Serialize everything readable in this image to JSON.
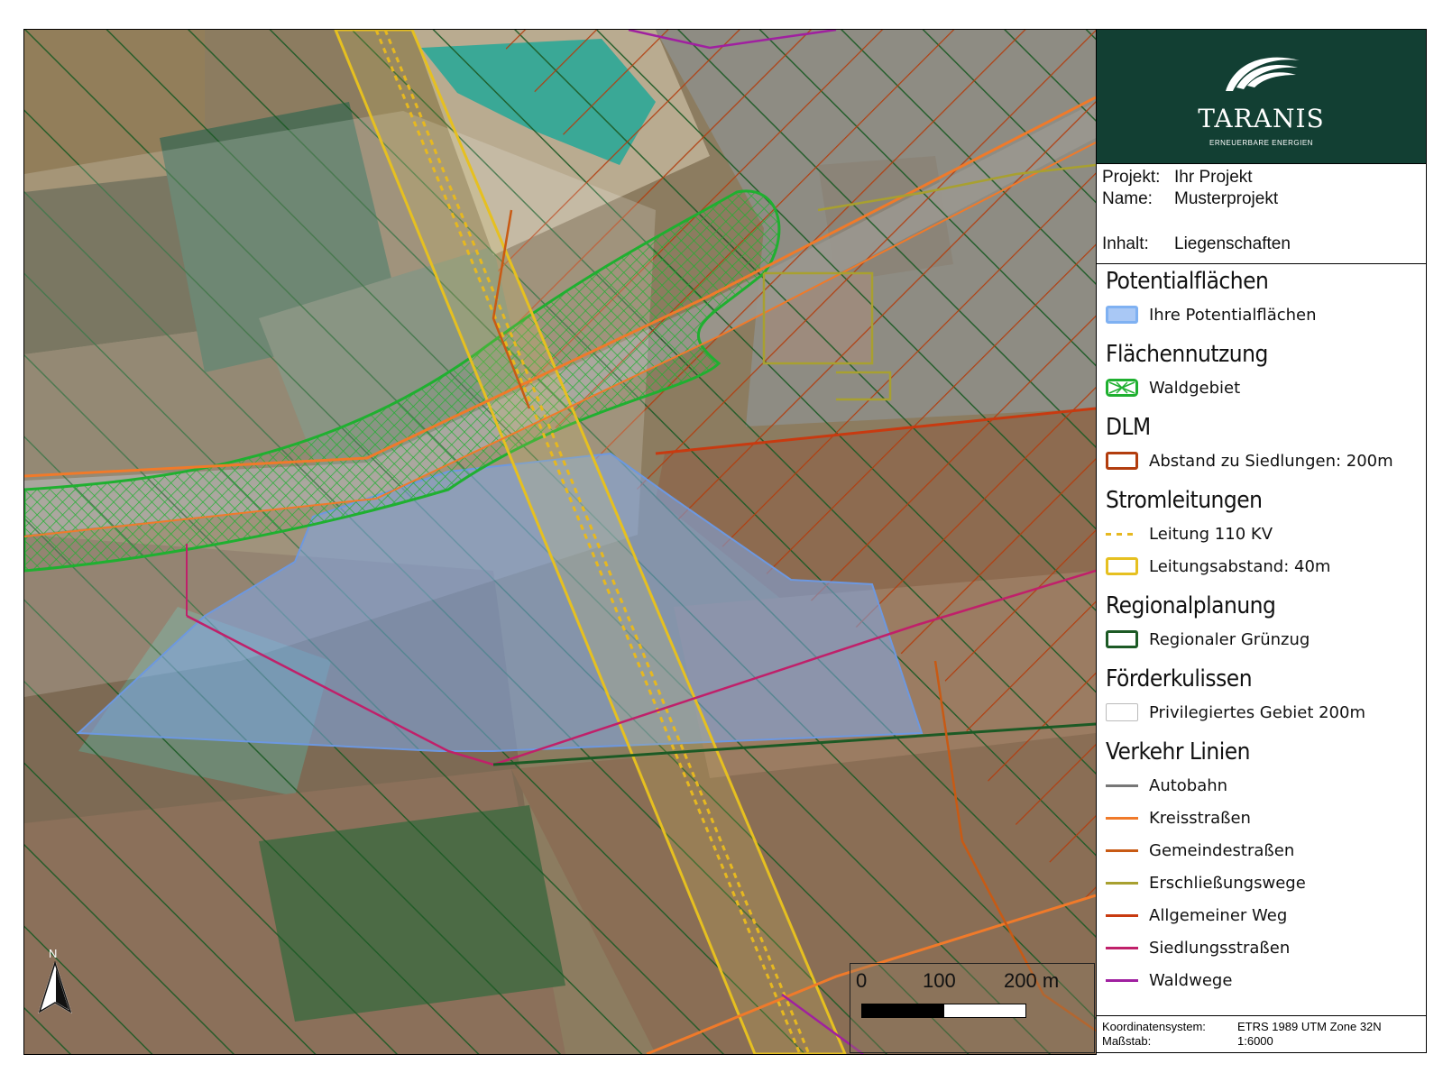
{
  "logo": {
    "brand": "TARANIS",
    "tagline": "ERNEUERBARE ENERGIEN"
  },
  "project": {
    "projekt_label": "Projekt:",
    "projekt_value": "Ihr Projekt",
    "name_label": "Name:",
    "name_value": "Musterprojekt",
    "inhalt_label": "Inhalt:",
    "inhalt_value": "Liegenschaften"
  },
  "legend": {
    "groups": [
      {
        "title": "Potentialflächen",
        "items": [
          {
            "label": "Ihre Potentialflächen",
            "color": "#7fb1f2"
          }
        ]
      },
      {
        "title": "Flächennutzung",
        "items": [
          {
            "label": "Waldgebiet",
            "color": "#1fb030"
          }
        ]
      },
      {
        "title": "DLM",
        "items": [
          {
            "label": "Abstand zu Siedlungen: 200m",
            "color": "#b23d0e"
          }
        ]
      },
      {
        "title": "Stromleitungen",
        "items": [
          {
            "label": "Leitung 110 KV",
            "color": "#e6b820"
          },
          {
            "label": "Leitungsabstand: 40m",
            "color": "#e6c020"
          }
        ]
      },
      {
        "title": "Regionalplanung",
        "items": [
          {
            "label": "Regionaler Grünzug",
            "color": "#1c5a25"
          }
        ]
      },
      {
        "title": "Förderkulissen",
        "items": [
          {
            "label": "Privilegiertes Gebiet 200m",
            "color": "#cccccc"
          }
        ]
      },
      {
        "title": "Verkehr Linien",
        "items": [
          {
            "label": "Autobahn",
            "color": "#777777"
          },
          {
            "label": "Kreisstraßen",
            "color": "#f07a2a"
          },
          {
            "label": "Gemeindestraßen",
            "color": "#c85a14"
          },
          {
            "label": "Erschließungswege",
            "color": "#a8a030"
          },
          {
            "label": "Allgemeiner Weg",
            "color": "#c83a10"
          },
          {
            "label": "Siedlungsstraßen",
            "color": "#c0206a"
          },
          {
            "label": "Waldwege",
            "color": "#a020a0"
          }
        ]
      }
    ]
  },
  "crs": {
    "label": "Koordinatensystem:",
    "value": "ETRS 1989 UTM Zone 32N",
    "scale_label": "Maßstab:",
    "scale_value": "1:6000"
  },
  "scalebar": {
    "tick_0": "0",
    "tick_100": "100",
    "tick_200": "200 m"
  },
  "north_arrow": {
    "label": "N"
  }
}
